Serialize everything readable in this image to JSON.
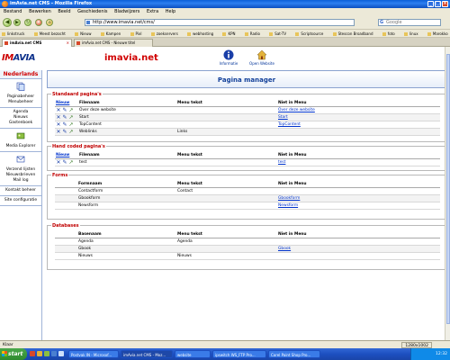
{
  "browser": {
    "window_title": "imAvia.net CMS - Mozilla Firefox",
    "menu": [
      "Bestand",
      "Bewerken",
      "Beeld",
      "Geschiedenis",
      "Bladwijzers",
      "Extra",
      "Help"
    ],
    "url": "http://www.imavia.net/cms/",
    "search_placeholder": "Google",
    "bookmarks": [
      "linkstruck",
      "Meest bezocht",
      "Nieuw",
      "Kampen",
      "Pixl",
      "zoekservers",
      "webhosting",
      "KPN",
      "Radio",
      "Sat-TV",
      "Scriptsource",
      "Stescon Broadband",
      "foto",
      "linux",
      "Marokko",
      "streaming"
    ],
    "tabs": [
      {
        "label": "imAvia.net CMS",
        "active": true
      },
      {
        "label": "imAvia.net CMS - Nieuwe titel",
        "active": false
      }
    ],
    "status_text": "Klaar",
    "resolution": "1280x1002"
  },
  "header": {
    "logo_text_a": "IM",
    "logo_text_b": "AVIA",
    "site_name": "imavia.net",
    "tools": [
      {
        "label": "Informatie",
        "icon": "info-icon"
      },
      {
        "label": "Open Website",
        "icon": "home-icon"
      }
    ]
  },
  "sidebar": {
    "language": "Nederlands",
    "sections": [
      {
        "icon": "pages-icon",
        "items": [
          "Paginabeheer",
          "Menubeheer"
        ]
      },
      {
        "icon": null,
        "items": [
          "Agenda",
          "Nieuws",
          "Gastenboek"
        ]
      },
      {
        "icon": "media-icon",
        "items": [
          "Media Explorer"
        ]
      },
      {
        "icon": "mail-icon",
        "items": [
          "Verzend lijsten",
          "Nieuwsbrieven",
          "Mail log"
        ]
      },
      {
        "icon": null,
        "items": [
          "Kontakt beheer"
        ]
      },
      {
        "icon": null,
        "items": [
          "Site configuratie"
        ]
      }
    ]
  },
  "main": {
    "page_title": "Pagina manager",
    "standard": {
      "title": "Standaard pagina's",
      "headers": [
        "Nieuw",
        "Filenaam",
        "Menu tekst",
        "Niet in Menu"
      ],
      "rows": [
        {
          "file": "Over deze website",
          "menu": "",
          "notmenu": "Over deze website"
        },
        {
          "file": "Start",
          "menu": "",
          "notmenu": "Start"
        },
        {
          "file": "TopContent",
          "menu": "",
          "notmenu": "TopContent"
        },
        {
          "file": "Weblinks",
          "menu": "Links",
          "notmenu": ""
        }
      ]
    },
    "handcoded": {
      "title": "Hand coded pagina's",
      "headers": [
        "Nieuw",
        "Filenaam",
        "Menu tekst",
        "Niet in Menu"
      ],
      "rows": [
        {
          "file": "test",
          "menu": "",
          "notmenu": "test"
        }
      ]
    },
    "forms": {
      "title": "Forms",
      "headers": [
        "Formnaam",
        "Menu tekst",
        "Niet in Menu"
      ],
      "rows": [
        {
          "name": "Contactform",
          "menu": "Contact",
          "notmenu": ""
        },
        {
          "name": "Gbookform",
          "menu": "",
          "notmenu": "Gbookform"
        },
        {
          "name": "Newsform",
          "menu": "",
          "notmenu": "Newsform"
        }
      ]
    },
    "databases": {
      "title": "Databases",
      "headers": [
        "Basenaam",
        "Menu tekst",
        "Niet in Menu"
      ],
      "rows": [
        {
          "name": "Agenda",
          "menu": "Agenda",
          "notmenu": ""
        },
        {
          "name": "Gbook",
          "menu": "",
          "notmenu": "Gbook"
        },
        {
          "name": "Nieuws",
          "menu": "Nieuws",
          "notmenu": ""
        }
      ]
    }
  },
  "taskbar": {
    "start_label": "start",
    "buttons": [
      "Postvak IN - Microsof...",
      "imAvia.net CMS - Moz...",
      "website",
      "ipswitch WS_FTP Pro...",
      "Corel Paint Shop Pro..."
    ],
    "clock": "12:32"
  },
  "colors": {
    "accent_red": "#d00000",
    "link_blue": "#0033cc",
    "title_blue": "#113f99"
  }
}
